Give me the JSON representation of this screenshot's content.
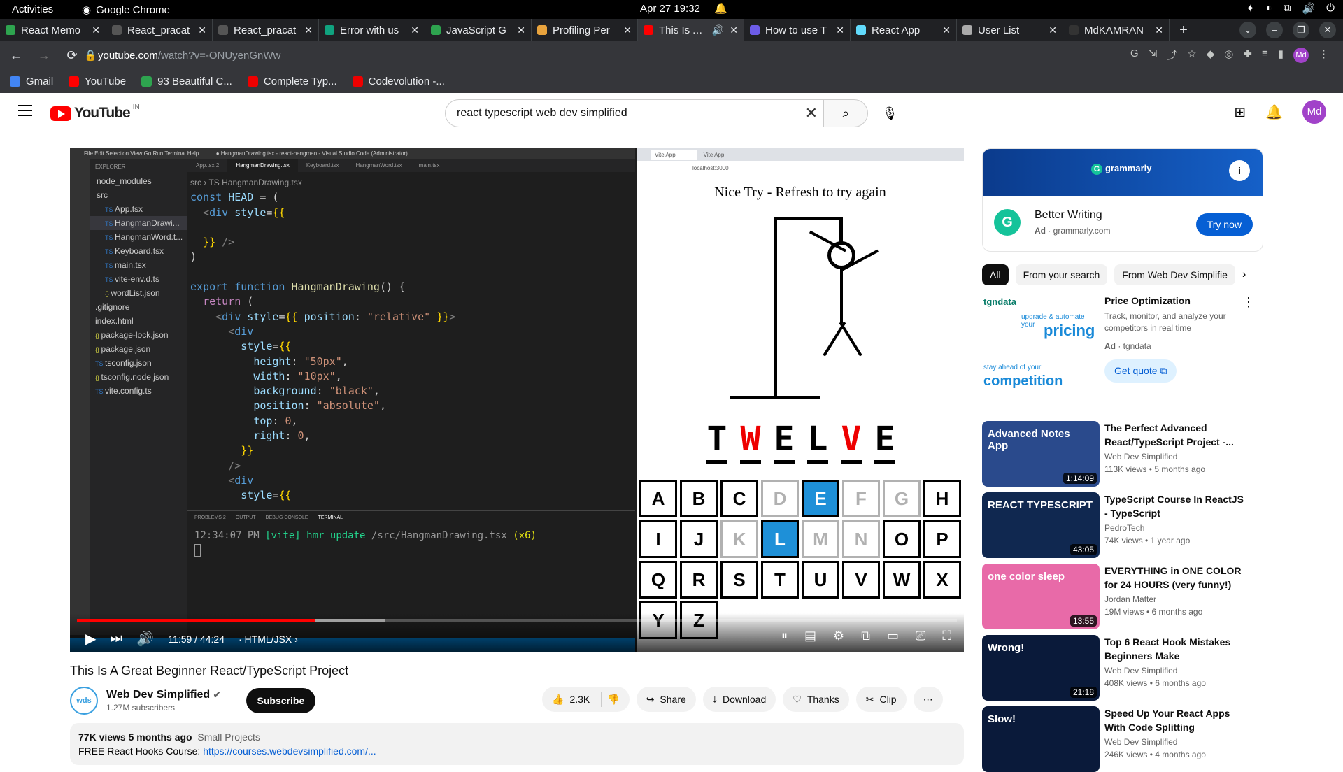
{
  "os": {
    "activities": "Activities",
    "app_name": "Google Chrome",
    "clock": "Apr 27  19:32"
  },
  "browser": {
    "tabs": [
      {
        "label": "React Memo",
        "color": "#2ea44f"
      },
      {
        "label": "React_pracat",
        "color": "#555"
      },
      {
        "label": "React_pracat",
        "color": "#555"
      },
      {
        "label": "Error with us",
        "color": "#10a37f"
      },
      {
        "label": "JavaScript G",
        "color": "#2ea44f"
      },
      {
        "label": "Profiling Per",
        "color": "#e8a33d"
      },
      {
        "label": "This Is A G",
        "color": "#f00"
      },
      {
        "label": "How to use T",
        "color": "#6c5ce7"
      },
      {
        "label": "React App",
        "color": "#61dafb"
      },
      {
        "label": "User List",
        "color": "#aaa"
      },
      {
        "label": "MdKAMRAN",
        "color": "#333"
      }
    ],
    "url_domain": "youtube.com",
    "url_path": "/watch?v=-ONUyenGnWw",
    "bookmarks": [
      "Gmail",
      "YouTube",
      "93 Beautiful C...",
      "Complete Typ...",
      "Codevolution -..."
    ],
    "profile": "Md"
  },
  "youtube": {
    "logo": "YouTube",
    "region": "IN",
    "search_value": "react typescript web dev simplified",
    "avatar": "Md"
  },
  "player": {
    "vscode": {
      "title": "● HangmanDrawing.tsx - react-hangman - Visual Studio Code (Administrator)",
      "menu": "File  Edit  Selection  View  Go  Run  Terminal  Help",
      "explorer_header": "EXPLORER",
      "files": [
        {
          "name": "node_modules",
          "kind": "dir"
        },
        {
          "name": "src",
          "kind": "dir"
        },
        {
          "name": "App.tsx",
          "kind": "ts"
        },
        {
          "name": "HangmanDrawi...",
          "kind": "ts",
          "selected": true
        },
        {
          "name": "HangmanWord.t...",
          "kind": "ts"
        },
        {
          "name": "Keyboard.tsx",
          "kind": "ts"
        },
        {
          "name": "main.tsx",
          "kind": "ts"
        },
        {
          "name": "vite-env.d.ts",
          "kind": "ts"
        },
        {
          "name": "wordList.json",
          "kind": "js"
        },
        {
          "name": ".gitignore",
          "kind": "other"
        },
        {
          "name": "index.html",
          "kind": "other"
        },
        {
          "name": "package-lock.json",
          "kind": "js"
        },
        {
          "name": "package.json",
          "kind": "js"
        },
        {
          "name": "tsconfig.json",
          "kind": "ts"
        },
        {
          "name": "tsconfig.node.json",
          "kind": "js"
        },
        {
          "name": "vite.config.ts",
          "kind": "ts"
        }
      ],
      "editor_tabs": [
        "App.tsx 2",
        "HangmanDrawing.tsx",
        "Keyboard.tsx",
        "HangmanWord.tsx",
        "main.tsx"
      ],
      "breadcrumb": "src › TS HangmanDrawing.tsx",
      "terminal_tabs": [
        "PROBLEMS 2",
        "OUTPUT",
        "DEBUG CONSOLE",
        "TERMINAL"
      ],
      "terminal_time": "12:34:07 PM",
      "terminal_vite": "[vite]",
      "terminal_msg": "hmr update",
      "terminal_path": "/src/HangmanDrawing.tsx",
      "terminal_count": "(x6)"
    },
    "game": {
      "tab1": "Vite App",
      "tab2": "Vite App",
      "url": "localhost:3000",
      "message": "Nice Try - Refresh to try again",
      "word": [
        {
          "ch": "T",
          "color": "#000"
        },
        {
          "ch": "W",
          "color": "#e00"
        },
        {
          "ch": "E",
          "color": "#000"
        },
        {
          "ch": "L",
          "color": "#000"
        },
        {
          "ch": "V",
          "color": "#e00"
        },
        {
          "ch": "E",
          "color": "#000"
        }
      ],
      "keys": [
        {
          "k": "A",
          "s": ""
        },
        {
          "k": "B",
          "s": ""
        },
        {
          "k": "C",
          "s": ""
        },
        {
          "k": "D",
          "s": "dis"
        },
        {
          "k": "E",
          "s": "act"
        },
        {
          "k": "F",
          "s": "dis"
        },
        {
          "k": "G",
          "s": "dis"
        },
        {
          "k": "H",
          "s": ""
        },
        {
          "k": "I",
          "s": ""
        },
        {
          "k": "J",
          "s": ""
        },
        {
          "k": "K",
          "s": "dis"
        },
        {
          "k": "L",
          "s": "act"
        },
        {
          "k": "M",
          "s": "dis"
        },
        {
          "k": "N",
          "s": "dis"
        },
        {
          "k": "O",
          "s": ""
        },
        {
          "k": "P",
          "s": ""
        },
        {
          "k": "Q",
          "s": ""
        },
        {
          "k": "R",
          "s": ""
        },
        {
          "k": "S",
          "s": ""
        },
        {
          "k": "T",
          "s": ""
        },
        {
          "k": "U",
          "s": ""
        },
        {
          "k": "V",
          "s": ""
        },
        {
          "k": "W",
          "s": ""
        },
        {
          "k": "X",
          "s": ""
        },
        {
          "k": "Y",
          "s": ""
        },
        {
          "k": "Z",
          "s": ""
        }
      ]
    },
    "controls": {
      "time": "11:59 / 44:24",
      "chapter": "· HTML/JSX ›",
      "played_fraction": 0.27,
      "buffered_fraction": 0.35
    }
  },
  "video": {
    "title": "This Is A Great Beginner React/TypeScript Project",
    "channel": "Web Dev Simplified",
    "channel_logo": "wds",
    "subscribers": "1.27M subscribers",
    "subscribe": "Subscribe",
    "likes": "2.3K",
    "share": "Share",
    "download": "Download",
    "thanks": "Thanks",
    "clip": "Clip",
    "views_line": "77K views  5 months ago",
    "tag": "Small Projects",
    "desc_prefix": "FREE React Hooks Course:",
    "desc_link": "https://courses.webdevsimplified.com/..."
  },
  "sidebar": {
    "ad": {
      "brand": "grammarly",
      "title": "Better Writing",
      "ad_label": "Ad",
      "domain": "grammarly.com",
      "cta": "Try now"
    },
    "chips": [
      "All",
      "From your search",
      "From Web Dev Simplifie"
    ],
    "ad2": {
      "title": "Price Optimization",
      "desc": "Track, monitor, and analyze your competitors in real time",
      "ad_label": "Ad",
      "source": "tgndata",
      "cta": "Get quote",
      "img_brand": "tgndata",
      "img_l1": "upgrade & automate your",
      "img_l2": "pricing",
      "img_l3": "stay ahead of your",
      "img_l4": "competition"
    },
    "recs": [
      {
        "title": "The Perfect Advanced React/TypeScript Project -...",
        "channel": "Web Dev Simplified",
        "meta": "113K views • 5 months ago",
        "duration": "1:14:09",
        "thumb_text": "Advanced Notes App",
        "bg": "#2a4a8c"
      },
      {
        "title": "TypeScript Course In ReactJS - TypeScript",
        "channel": "PedroTech",
        "meta": "74K views • 1 year ago",
        "duration": "43:05",
        "thumb_text": "REACT TYPESCRIPT",
        "bg": "#102850"
      },
      {
        "title": "EVERYTHING in ONE COLOR for 24 HOURS (very funny!)",
        "channel": "Jordan Matter",
        "meta": "19M views • 6 months ago",
        "duration": "13:55",
        "thumb_text": "one color sleep",
        "bg": "#e86aa8"
      },
      {
        "title": "Top 6 React Hook Mistakes Beginners Make",
        "channel": "Web Dev Simplified",
        "meta": "408K views • 6 months ago",
        "duration": "21:18",
        "thumb_text": "Wrong!",
        "bg": "#0a1a3a"
      },
      {
        "title": "Speed Up Your React Apps With Code Splitting",
        "channel": "Web Dev Simplified",
        "meta": "246K views • 4 months ago",
        "duration": "",
        "thumb_text": "Slow!",
        "bg": "#0a1a3a"
      }
    ]
  }
}
